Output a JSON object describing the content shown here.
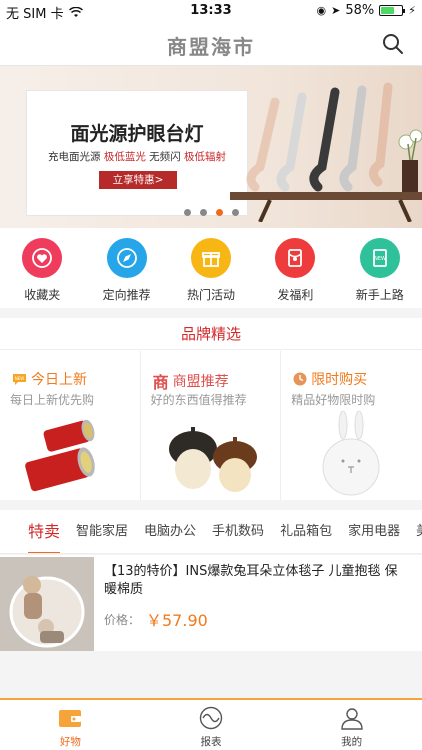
{
  "status_bar": {
    "carrier": "无 SIM 卡",
    "time": "13:33",
    "battery": "58%"
  },
  "nav": {
    "title": "商盟海市",
    "search_icon": "search-icon"
  },
  "banner": {
    "title": "面光源护眼台灯",
    "sub_prefix": "充电面光源",
    "sub_highlight1": "极低蓝光",
    "sub_middle": "无频闪",
    "sub_highlight2": "极低辐射",
    "button": "立享特惠>",
    "slide_count": 4,
    "active_slide": 3
  },
  "quick_nav": [
    {
      "label": "收藏夹",
      "icon": "heart-icon",
      "color": "#ef3b5c"
    },
    {
      "label": "定向推荐",
      "icon": "compass-icon",
      "color": "#26a6e8"
    },
    {
      "label": "热门活动",
      "icon": "gift-icon",
      "color": "#f7b614"
    },
    {
      "label": "发福利",
      "icon": "red-envelope-icon",
      "color": "#ee3b3b"
    },
    {
      "label": "新手上路",
      "icon": "new-book-icon",
      "color": "#2fc29a"
    }
  ],
  "brand": {
    "header": "品牌精选",
    "columns": [
      {
        "title": "今日上新",
        "subtitle": "每日上新优先购",
        "icon": "new-badge-icon",
        "title_color": "#f07a1d"
      },
      {
        "title": "商盟推荐",
        "subtitle": "好的东西值得推荐",
        "icon": "shang-logo-icon",
        "title_color": "#e0504f"
      },
      {
        "title": "限时购买",
        "subtitle": "精品好物限时购",
        "icon": "clock-icon",
        "title_color": "#f07a1d"
      }
    ]
  },
  "tabs": [
    "特卖",
    "智能家居",
    "电脑办公",
    "手机数码",
    "礼品箱包",
    "家用电器",
    "美"
  ],
  "product": {
    "title": "【13的特价】INS爆款兔耳朵立体毯子 儿童抱毯 保暖棉质",
    "price_label": "价格：",
    "price": "￥57.90"
  },
  "tab_bar": [
    {
      "label": "好物",
      "icon": "wallet-icon",
      "active": true
    },
    {
      "label": "报表",
      "icon": "wave-chart-icon",
      "active": false
    },
    {
      "label": "我的",
      "icon": "user-icon",
      "active": false
    }
  ],
  "colors": {
    "accent": "#f06a1d",
    "brand_red": "#d22a2a"
  }
}
